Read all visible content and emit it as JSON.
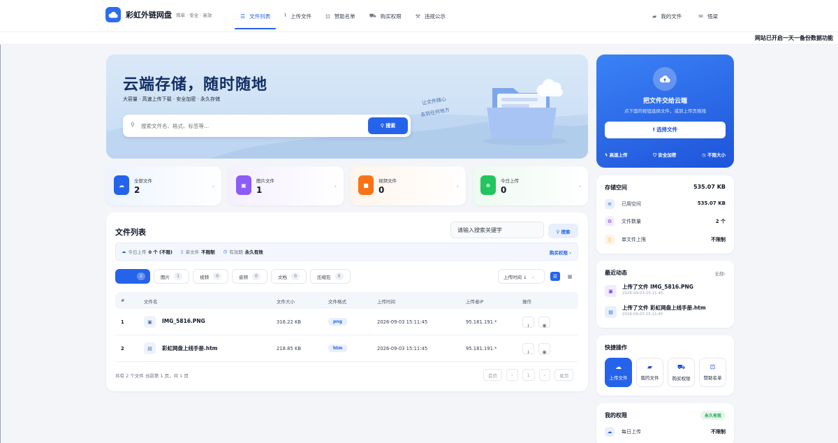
{
  "brand": {
    "name": "彩虹外链网盘",
    "tagline": "简单 · 安全 · 高效"
  },
  "nav": {
    "items": [
      {
        "label": "文件列表",
        "icon": "list-icon",
        "active": true
      },
      {
        "label": "上传文件",
        "icon": "upload-icon",
        "active": false
      },
      {
        "label": "赞助名单",
        "icon": "sponsor-icon",
        "active": false
      },
      {
        "label": "购买权限",
        "icon": "cart-icon",
        "active": false
      },
      {
        "label": "违规公示",
        "icon": "gavel-icon",
        "active": false
      }
    ],
    "right": [
      {
        "label": "我的文件",
        "icon": "folder-icon"
      },
      {
        "label": "悟梁",
        "icon": "mail-icon"
      }
    ]
  },
  "marquee": "网站已开启一天一备份数据功能",
  "hero": {
    "title": "云端存储，随时随地",
    "subtitle": "大容量 · 高速上传下载 · 安全加密 · 永久存储",
    "search_placeholder": "搜索文件名、格式、标签等...",
    "search_button": "搜索",
    "handwriting_1": "让文件随心",
    "handwriting_2": "去到任何地方"
  },
  "upload_card": {
    "title": "把文件交给云端",
    "subtitle": "点下面的按钮选择文件，或到上传页拖拽",
    "button": "选择文件",
    "features": [
      "高速上传",
      "安全加密",
      "不限大小"
    ]
  },
  "stats": [
    {
      "label": "全部文件",
      "value": "2",
      "color": "#2563eb",
      "bg": "#eef4ff",
      "icon": "cloud-icon"
    },
    {
      "label": "图片文件",
      "value": "1",
      "color": "#8b5cf6",
      "bg": "#f5f0ff",
      "icon": "image-icon"
    },
    {
      "label": "视频文件",
      "value": "0",
      "color": "#f97316",
      "bg": "#fff5ec",
      "icon": "video-icon"
    },
    {
      "label": "今日上传",
      "value": "0",
      "color": "#22c55e",
      "bg": "#eefaf1",
      "icon": "plus-icon"
    }
  ],
  "file_list": {
    "title": "文件列表",
    "search_value": "请输入搜索关键字",
    "search_button": "搜索",
    "quota": [
      {
        "label": "今日上传",
        "value": "0 个 (不限)"
      },
      {
        "label": "单文件",
        "value": "不限制"
      },
      {
        "label": "有效期",
        "value": "永久有效"
      }
    ],
    "buy_link": "购买权限 ›",
    "filters": [
      {
        "label": "",
        "count": "2",
        "active": true
      },
      {
        "label": "图片",
        "count": "1"
      },
      {
        "label": "视频",
        "count": "0"
      },
      {
        "label": "音频",
        "count": "0"
      },
      {
        "label": "文档",
        "count": "0"
      },
      {
        "label": "压缩包",
        "count": "0"
      }
    ],
    "sort_label": "上传时间 ↓",
    "columns": [
      "#",
      "文件名",
      "文件大小",
      "文件格式",
      "上传时间",
      "上传者IP",
      "操作"
    ],
    "rows": [
      {
        "num": "1",
        "name": "IMG_5816.PNG",
        "size": "316.22 KB",
        "format": "png",
        "time": "2026-09-03 15:11:45",
        "ip": "95.181.191.*"
      },
      {
        "num": "2",
        "name": "彩虹网盘上线手册.htm",
        "size": "218.85 KB",
        "format": "htm",
        "time": "2026-09-03 15:11:45",
        "ip": "95.181.191.*"
      }
    ],
    "pager_info": "共有 2 个文件  当前第 1 页，共 1 页",
    "pager": [
      "首页",
      "‹",
      "1",
      "›",
      "尾页"
    ]
  },
  "storage": {
    "title": "存储空间",
    "total": "535.07 KB",
    "rows": [
      {
        "label": "已用空间",
        "value": "535.07 KB"
      },
      {
        "label": "文件数量",
        "value": "2 个"
      },
      {
        "label": "单文件上限",
        "value": "不限制"
      }
    ]
  },
  "activity": {
    "title": "最近动态",
    "all_link": "全部›",
    "items": [
      {
        "text": "上传了文件 IMG_5816.PNG",
        "date": "2026-09-03 15:11:45"
      },
      {
        "text": "上传了文件 彩虹网盘上线手册.htm",
        "date": "2026-09-03 15:11:45"
      }
    ]
  },
  "quick": {
    "title": "快捷操作",
    "items": [
      "上传文件",
      "我的文件",
      "购买权限",
      "赞助名单"
    ]
  },
  "perm": {
    "title": "我的权限",
    "badge": "永久有效",
    "row_label": "每日上传",
    "row_value": "不限制"
  }
}
